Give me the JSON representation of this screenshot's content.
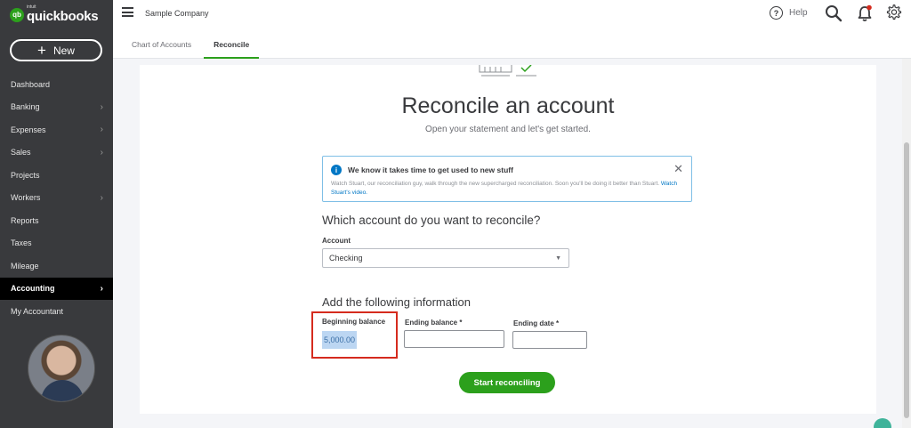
{
  "brand": {
    "intuit": "intuit",
    "name": "quickbooks",
    "mark": "qb"
  },
  "new_button": {
    "label": "New",
    "plus": "+"
  },
  "sidebar": {
    "items": [
      {
        "label": "Dashboard",
        "chevron": false
      },
      {
        "label": "Banking",
        "chevron": true
      },
      {
        "label": "Expenses",
        "chevron": true
      },
      {
        "label": "Sales",
        "chevron": true
      },
      {
        "label": "Projects",
        "chevron": false
      },
      {
        "label": "Workers",
        "chevron": true
      },
      {
        "label": "Reports",
        "chevron": false
      },
      {
        "label": "Taxes",
        "chevron": false
      },
      {
        "label": "Mileage",
        "chevron": false
      },
      {
        "label": "Accounting",
        "chevron": true,
        "active": true
      },
      {
        "label": "My Accountant",
        "chevron": false
      }
    ]
  },
  "topbar": {
    "company": "Sample Company",
    "help_label": "Help",
    "help_symbol": "?",
    "tabs": [
      {
        "label": "Chart of Accounts"
      },
      {
        "label": "Reconcile",
        "active": true
      }
    ]
  },
  "main": {
    "title": "Reconcile an account",
    "subtitle": "Open your statement and let's get started.",
    "info": {
      "icon": "i",
      "title": "We know it takes time to get used to new stuff",
      "body": "Watch Stuart, our reconciliation guy, walk through the new supercharged reconciliation. Soon you'll be doing it better than Stuart.",
      "link": "Watch Stuart's video.",
      "close": "✕"
    },
    "which_heading": "Which account do you want to reconcile?",
    "account_label": "Account",
    "account_value": "Checking",
    "add_heading": "Add the following information",
    "beginning_label": "Beginning balance",
    "beginning_value": "5,000.00",
    "ending_label": "Ending balance *",
    "ending_value": "",
    "date_label": "Ending date *",
    "date_value": "",
    "start_button": "Start reconciling"
  },
  "colors": {
    "sidebar_bg": "#393a3d",
    "accent_green": "#2ca01c",
    "link_blue": "#0077c5",
    "highlight_red": "#d52b1e"
  }
}
